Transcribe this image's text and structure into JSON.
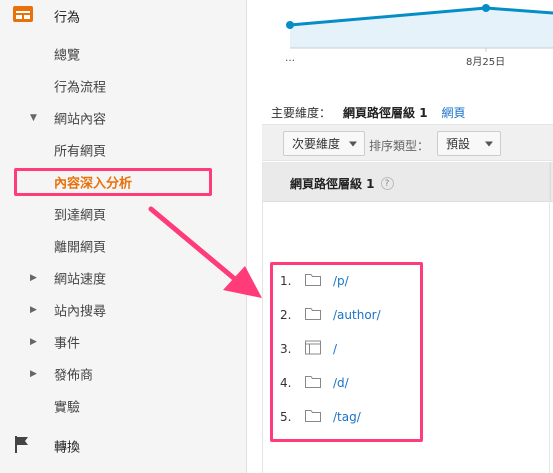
{
  "sidebar": {
    "behavior_label": "行為",
    "items": [
      {
        "label": "總覽"
      },
      {
        "label": "行為流程"
      },
      {
        "label": "網站內容"
      },
      {
        "label": "所有網頁"
      },
      {
        "label": "內容深入分析"
      },
      {
        "label": "到達網頁"
      },
      {
        "label": "離開網頁"
      },
      {
        "label": "網站速度"
      },
      {
        "label": "站內搜尋"
      },
      {
        "label": "事件"
      },
      {
        "label": "發佈商"
      },
      {
        "label": "實驗"
      }
    ],
    "conversions_label": "轉換",
    "arrow_expanded": "▼",
    "arrow_collapsed": "▶"
  },
  "chart": {
    "x_tick_left": "…",
    "x_tick_mid": "8月25日",
    "line_color": "#058dc7",
    "fill_color": "#e6f2f9"
  },
  "dimension": {
    "primary_label": "主要維度：",
    "current": "網頁路徑層級 1",
    "alt_link": "網頁"
  },
  "toolbar": {
    "secondary_dimension": "次要維度",
    "sort_type_label": "排序類型：",
    "sort_default": "預設"
  },
  "table": {
    "column_header": "網頁路徑層級 1",
    "help": "?",
    "rows": [
      {
        "num": "1.",
        "icon": "folder-icon",
        "path": "/p/"
      },
      {
        "num": "2.",
        "icon": "folder-icon",
        "path": "/author/"
      },
      {
        "num": "3.",
        "icon": "page-icon",
        "path": "/"
      },
      {
        "num": "4.",
        "icon": "folder-icon",
        "path": "/d/"
      },
      {
        "num": "5.",
        "icon": "folder-icon",
        "path": "/tag/"
      }
    ]
  },
  "colors": {
    "accent_orange": "#e8710a",
    "annotation_pink": "#ff3b7a",
    "link_blue": "#1a73c8"
  }
}
